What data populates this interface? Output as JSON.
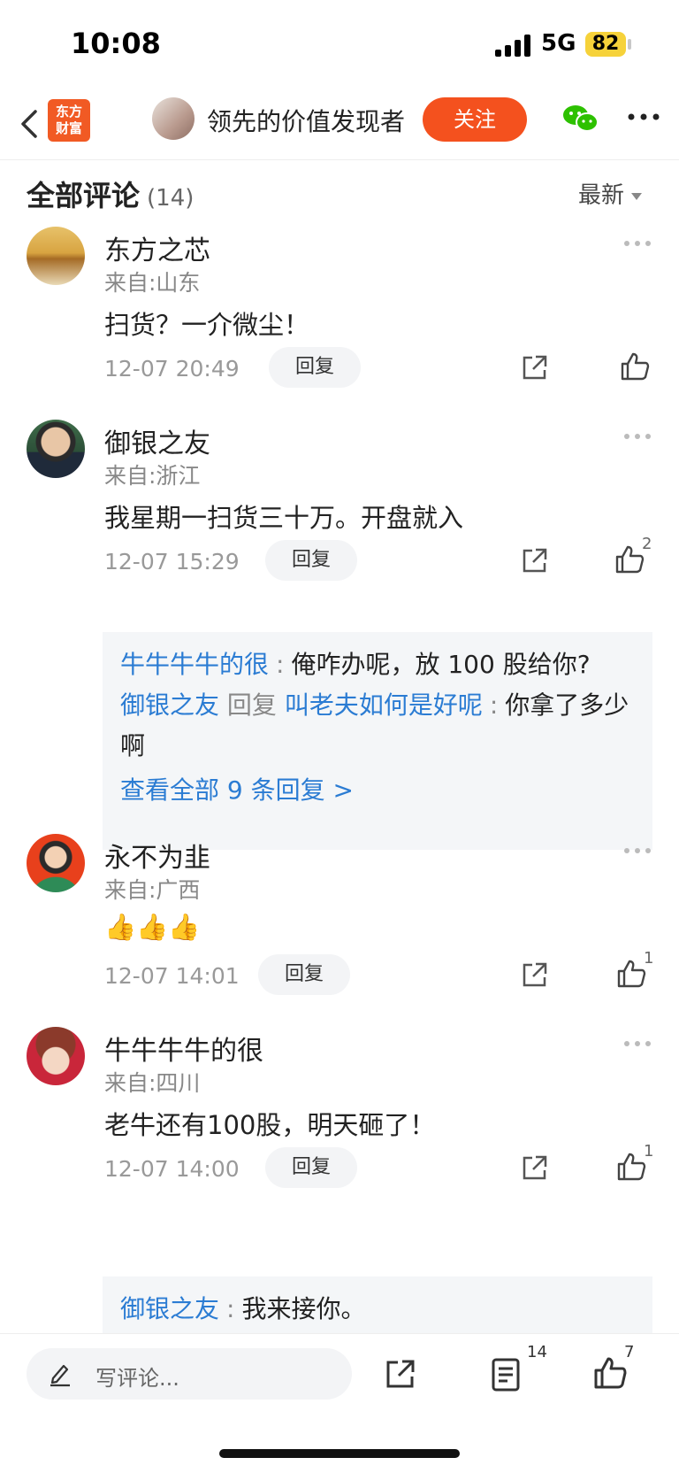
{
  "status": {
    "time": "10:08",
    "network": "5G",
    "battery": "82"
  },
  "nav": {
    "logo_line1": "东方",
    "logo_line2": "财富",
    "author": "领先的价值发现者",
    "follow": "关注"
  },
  "header": {
    "title": "全部评论",
    "count": "(14)",
    "sort": "最新"
  },
  "comments": [
    {
      "user": "东方之芯",
      "from": "来自:山东",
      "text": "扫货？一介微尘！",
      "time": "12-07 20:49",
      "reply": "回复",
      "likes": ""
    },
    {
      "user": "御银之友",
      "from": "来自:浙江",
      "text": "我星期一扫货三十万。开盘就入",
      "time": "12-07 15:29",
      "reply": "回复",
      "likes": "2",
      "replies": {
        "r1_user": "牛牛牛牛的很",
        "r1_text": "俺咋办呢，放 100 股给你?",
        "r2_user": "御银之友",
        "r2_mid": "回复",
        "r2_target": "叫老夫如何是好呢",
        "r2_text": "你拿了多少啊",
        "view_all": "查看全部 9 条回复 >"
      }
    },
    {
      "user": "永不为韭",
      "from": "来自:广西",
      "text": "👍👍👍",
      "time": "12-07 14:01",
      "reply": "回复",
      "likes": "1"
    },
    {
      "user": "牛牛牛牛的很",
      "from": "来自:四川",
      "text": "老牛还有100股，明天砸了！",
      "time": "12-07 14:00",
      "reply": "回复",
      "likes": "1",
      "replies": {
        "r1_user": "御银之友",
        "r1_text": "我来接你。"
      }
    }
  ],
  "bottom": {
    "placeholder": "写评论...",
    "comment_count": "14",
    "like_count": "7"
  },
  "colors": {
    "accent": "#f4511e",
    "link": "#2b7cd3",
    "wechat": "#2dc100"
  },
  "icons": [
    "back-icon",
    "wechat-icon",
    "more-icon",
    "share-icon",
    "like-icon",
    "pen-icon",
    "comments-icon"
  ]
}
